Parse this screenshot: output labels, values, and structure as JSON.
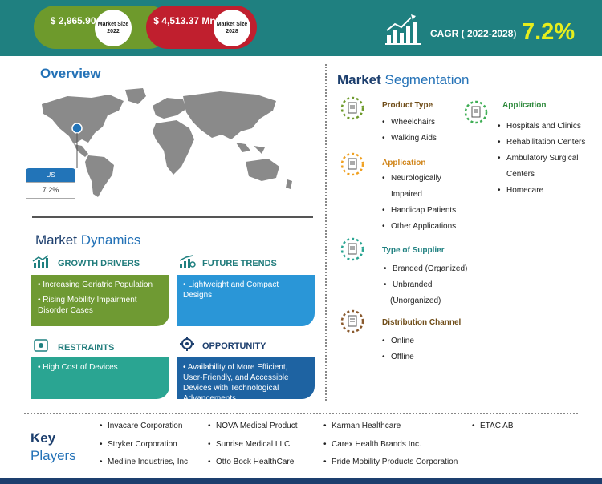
{
  "header": {
    "market_2022": {
      "value": "$ 2,965.90 Mn",
      "label": "Market Size 2022"
    },
    "market_2028": {
      "value": "$ 4,513.37 Mn",
      "label": "Market Size 2028"
    },
    "cagr_label": "CAGR ( 2022-2028)",
    "cagr_value": "7.2%"
  },
  "overview": {
    "title": "Overview",
    "region": "US",
    "region_value": "7.2%"
  },
  "dynamics": {
    "title_a": "Market",
    "title_b": " Dynamics",
    "growth_drivers": {
      "heading": "GROWTH DRIVERS",
      "items": [
        "Increasing Geriatric Population",
        "Rising Mobility Impairment Disorder Cases"
      ]
    },
    "future_trends": {
      "heading": "FUTURE TRENDS",
      "items": [
        "Lightweight and Compact Designs"
      ]
    },
    "restraints": {
      "heading": "RESTRAINTS",
      "items": [
        "High Cost of Devices"
      ]
    },
    "opportunity": {
      "heading": "OPPORTUNITY",
      "items": [
        "Availability of More Efficient, User-Friendly, and Accessible Devices with Technological Advancements"
      ]
    }
  },
  "segmentation": {
    "title_a": "Market",
    "title_b": " Segmentation",
    "product_type": {
      "heading": "Product Type",
      "items": [
        "Wheelchairs",
        "Walking Aids"
      ]
    },
    "application_left": {
      "heading": "Application",
      "items": [
        "Neurologically",
        "Impaired",
        "Handicap Patients",
        "Other Applications"
      ]
    },
    "type_of_supplier": {
      "heading": "Type of Supplier",
      "items": [
        "Branded (Organized)",
        "Unbranded",
        "(Unorganized)"
      ]
    },
    "distribution_channel": {
      "heading": "Distribution Channel",
      "items": [
        "Online",
        "Offline"
      ]
    },
    "application_right": {
      "heading": "Application",
      "items": [
        "Hospitals and Clinics",
        "Rehabilitation Centers",
        "Ambulatory Surgical",
        "Centers",
        "Homecare"
      ]
    }
  },
  "key_players": {
    "title_a": "Key",
    "title_b": "Players",
    "names": [
      "Invacare Corporation",
      "NOVA Medical Product",
      "Karman Healthcare",
      "ETAC AB",
      "Stryker Corporation",
      "Sunrise Medical LLC",
      "Carex Health Brands Inc.",
      "Medline Industries, Inc",
      "Otto Bock HealthCare",
      "Pride Mobility Products Corporation"
    ]
  },
  "colors": {
    "teal": "#1f8080",
    "green": "#6e9a2c",
    "red": "#c01f2e",
    "yellow": "#e6ee1d",
    "navy": "#1d3f6e",
    "blue": "#2472b7"
  },
  "chart_data": {
    "type": "table",
    "market_size_2022": "$ 2,965.90 Mn",
    "market_size_2028": "$ 4,513.37 Mn",
    "cagr_period": "2022-2028",
    "cagr": "7.2%"
  }
}
